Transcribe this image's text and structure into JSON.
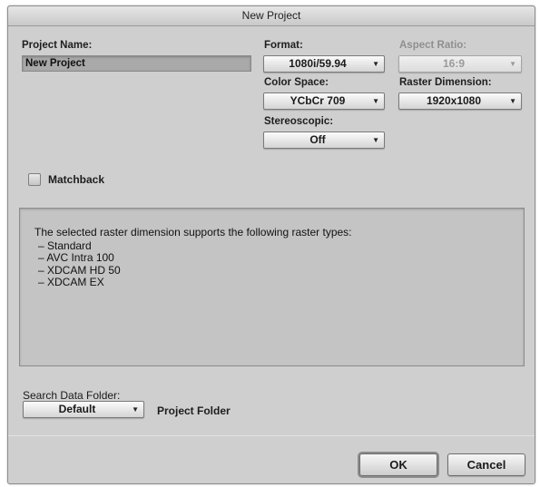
{
  "window": {
    "title": "New Project"
  },
  "project_name": {
    "label": "Project Name:",
    "value": "New Project"
  },
  "format": {
    "label": "Format:",
    "value": "1080i/59.94"
  },
  "aspect_ratio": {
    "label": "Aspect Ratio:",
    "value": "16:9",
    "enabled": false
  },
  "color_space": {
    "label": "Color Space:",
    "value": "YCbCr 709"
  },
  "raster_dimension": {
    "label": "Raster Dimension:",
    "value": "1920x1080"
  },
  "stereoscopic": {
    "label": "Stereoscopic:",
    "value": "Off"
  },
  "matchback": {
    "label": "Matchback",
    "checked": false
  },
  "raster_info": {
    "intro": "The selected raster dimension supports the following raster types:",
    "types": [
      "Standard",
      "AVC Intra 100",
      "XDCAM HD 50",
      "XDCAM EX"
    ]
  },
  "search_data_folder": {
    "label": "Search Data Folder:",
    "value": "Default",
    "folder_text": "Project Folder"
  },
  "buttons": {
    "ok": "OK",
    "cancel": "Cancel"
  },
  "icons": {
    "dropdown": "chevron-down-icon"
  }
}
